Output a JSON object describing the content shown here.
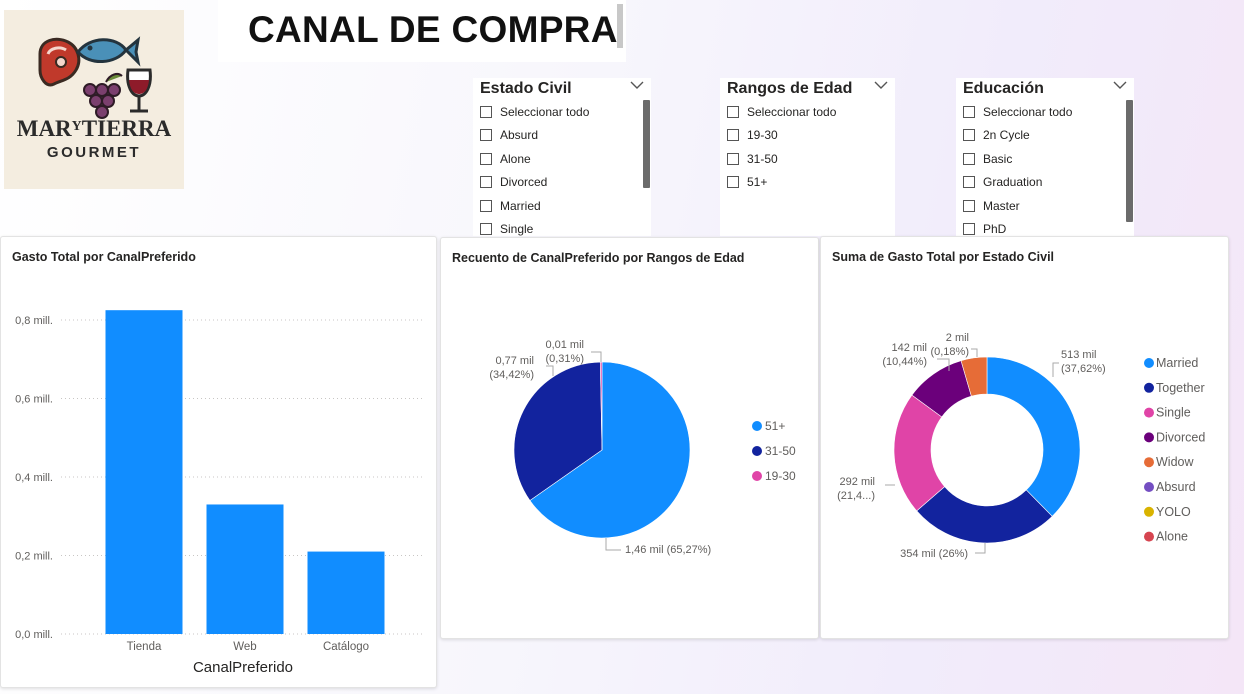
{
  "logo": {
    "line1_a": "MAR",
    "line1_b": "Y",
    "line1_c": "TIERRA",
    "line2": "GOURMET",
    "icons": [
      "meat-icon",
      "fish-icon",
      "grapes-icon",
      "wine-glass-icon"
    ]
  },
  "title": "CANAL DE COMPRA",
  "slicers": {
    "estado_civil": {
      "header": "Estado Civil",
      "items": [
        "Seleccionar todo",
        "Absurd",
        "Alone",
        "Divorced",
        "Married",
        "Single"
      ]
    },
    "rangos_edad": {
      "header": "Rangos de Edad",
      "items": [
        "Seleccionar todo",
        "19-30",
        "31-50",
        "51+"
      ]
    },
    "educacion": {
      "header": "Educación",
      "items": [
        "Seleccionar todo",
        "2n Cycle",
        "Basic",
        "Graduation",
        "Master",
        "PhD"
      ]
    }
  },
  "colors": {
    "bar": "#118dff",
    "grid": "#c8c6c4",
    "axis_text": "#605e5c"
  },
  "chart_data": [
    {
      "type": "bar",
      "title": "Gasto Total por CanalPreferido",
      "xlabel": "CanalPreferido",
      "ylabel": "",
      "categories": [
        "Tienda",
        "Web",
        "Catálogo"
      ],
      "values": [
        0.825,
        0.33,
        0.21
      ],
      "ylim": [
        0,
        0.8
      ],
      "yticks": [
        0,
        0.2,
        0.4,
        0.6,
        0.8
      ],
      "ytick_labels": [
        "0,0 mill.",
        "0,2 mill.",
        "0,4 mill.",
        "0,6 mill.",
        "0,8 mill."
      ],
      "grid": true
    },
    {
      "type": "pie",
      "title": "Recuento de CanalPreferido por Rangos de Edad",
      "legend_position": "right",
      "slices": [
        {
          "name": "51+",
          "value": 1460,
          "percent": 65.27,
          "label": "1,46 mil (65,27%)",
          "color": "#118dff"
        },
        {
          "name": "31-50",
          "value": 770,
          "percent": 34.42,
          "label": "0,77 mil (34,42%)",
          "color": "#12239e"
        },
        {
          "name": "19-30",
          "value": 10,
          "percent": 0.31,
          "label": "0,01 mil (0,31%)",
          "color": "#e044a7"
        }
      ]
    },
    {
      "type": "pie",
      "donut": true,
      "title": "Suma de Gasto Total por Estado Civil",
      "legend_position": "right",
      "slices": [
        {
          "name": "Married",
          "value": 513,
          "percent": 37.62,
          "label_a": "513 mil",
          "label_b": "(37,62%)",
          "color": "#118dff"
        },
        {
          "name": "Together",
          "value": 354,
          "percent": 26,
          "label_a": "354 mil (26%)",
          "label_b": "",
          "color": "#12239e"
        },
        {
          "name": "Single",
          "value": 292,
          "percent": 21.4,
          "label_a": "292 mil",
          "label_b": "(21,4...)",
          "color": "#e044a7"
        },
        {
          "name": "Divorced",
          "value": 142,
          "percent": 10.44,
          "label_a": "142 mil",
          "label_b": "(10,44%)",
          "color": "#6b007b"
        },
        {
          "name": "Widow",
          "value": 2,
          "percent": 0.18,
          "label_a": "2 mil",
          "label_b": "(0,18%)",
          "color": "#e66c37"
        },
        {
          "name": "Absurd",
          "value": 0,
          "percent": 0,
          "color": "#744ec2"
        },
        {
          "name": "YOLO",
          "value": 0,
          "percent": 0,
          "color": "#d9b300"
        },
        {
          "name": "Alone",
          "value": 0,
          "percent": 0,
          "color": "#d64550"
        }
      ],
      "donut_display_percent": {
        "Married": 37.62,
        "Together": 26,
        "Single": 21.4,
        "Divorced": 10.44,
        "Widow": 4.5
      }
    }
  ]
}
